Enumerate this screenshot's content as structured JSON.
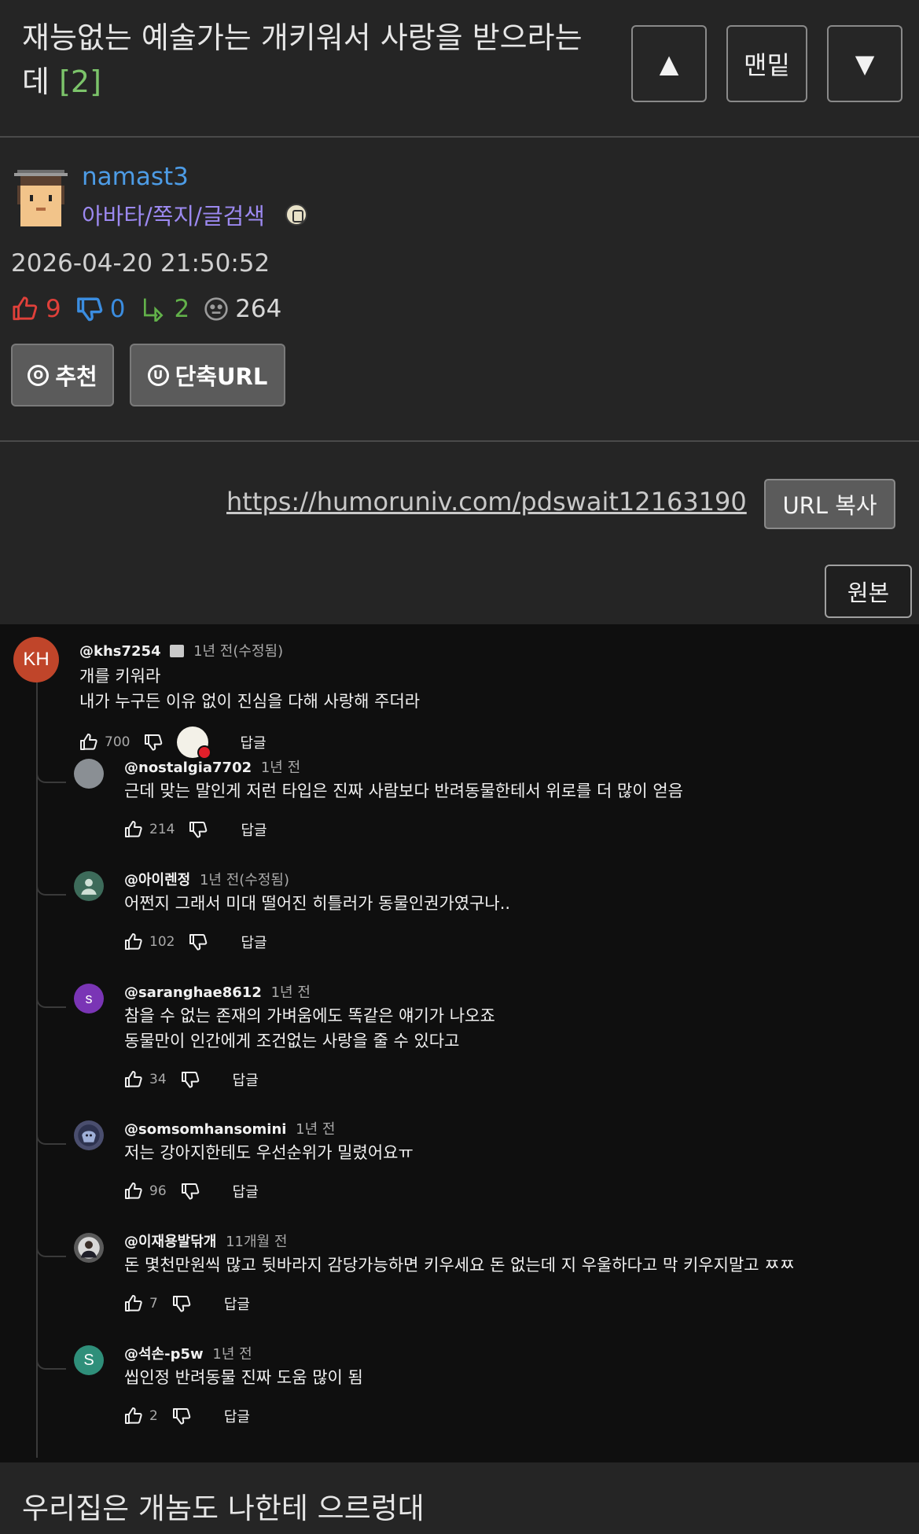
{
  "header": {
    "title": "재능없는 예술가는 개키워서 사랑을 받으라는데",
    "comment_count": "[2]",
    "up_button": "▲",
    "bottom_button": "맨밑",
    "down_button": "▼"
  },
  "author": {
    "name": "namast3",
    "links": "아바타/쪽지/글검색",
    "date": "2026-04-20 21:50:52",
    "stats": {
      "up": "9",
      "down": "0",
      "replies": "2",
      "views": "264"
    },
    "recommend_button": "추천",
    "recommend_icon_char": "O",
    "short_url_button": "단축URL",
    "short_url_icon_char": "U"
  },
  "url_row": {
    "url": "https://humoruniv.com/pdswait12163190",
    "copy_button": "URL 복사",
    "original_button": "원본"
  },
  "screenshot": {
    "top_comment": {
      "avatar_text": "KH",
      "avatar_color": "#c0452a",
      "handle": "@khs7254",
      "time": "1년 전(수정됨)",
      "lines": [
        "개를 키워라",
        "내가 누구든 이유 없이 진심을 다해 사랑해 주더라"
      ],
      "likes": "700",
      "reply": "답글"
    },
    "replies": [
      {
        "handle": "@nostalgia7702",
        "time": "1년 전",
        "avatar_text": "",
        "avatar_color": "#8a8f94",
        "lines": [
          "근데 맞는 말인게 저런 타입은 진짜 사람보다  반려동물한테서 위로를 더 많이 얻음"
        ],
        "likes": "214",
        "reply": "답글"
      },
      {
        "handle": "@아이렌정",
        "time": "1년 전(수정됨)",
        "avatar_text": "",
        "avatar_color": "#3d6b5a",
        "lines": [
          "어쩐지 그래서 미대 떨어진 히틀러가 동물인권가였구나.."
        ],
        "likes": "102",
        "reply": "답글"
      },
      {
        "handle": "@saranghae8612",
        "time": "1년 전",
        "avatar_text": "s",
        "avatar_color": "#7a35b5",
        "lines": [
          "참을 수 없는 존재의 가벼움에도 똑같은 얘기가 나오죠",
          "동물만이 인간에게 조건없는 사랑을 줄 수 있다고"
        ],
        "likes": "34",
        "reply": "답글"
      },
      {
        "handle": "@somsomhansomini",
        "time": "1년 전",
        "avatar_text": "",
        "avatar_color": "#4a4e6e",
        "lines": [
          "저는 강아지한테도 우선순위가 밀렸어요ㅠ"
        ],
        "likes": "96",
        "reply": "답글"
      },
      {
        "handle": "@이재용발닦개",
        "time": "11개월 전",
        "avatar_text": "",
        "avatar_color": "#5a5a5a",
        "lines": [
          "돈 몇천만원씩 많고 뒷바라지 감당가능하면 키우세요 돈 없는데 지 우울하다고 막 키우지말고 ㅉㅉ"
        ],
        "likes": "7",
        "reply": "답글"
      },
      {
        "handle": "@석손-p5w",
        "time": "1년 전",
        "avatar_text": "S",
        "avatar_color": "#2f8f7a",
        "lines": [
          "씹인정 반려동물 진짜 도움 많이 됨"
        ],
        "likes": "2",
        "reply": "답글"
      }
    ]
  },
  "bottom_text": "우리집은 개놈도 나한테 으르렁대"
}
